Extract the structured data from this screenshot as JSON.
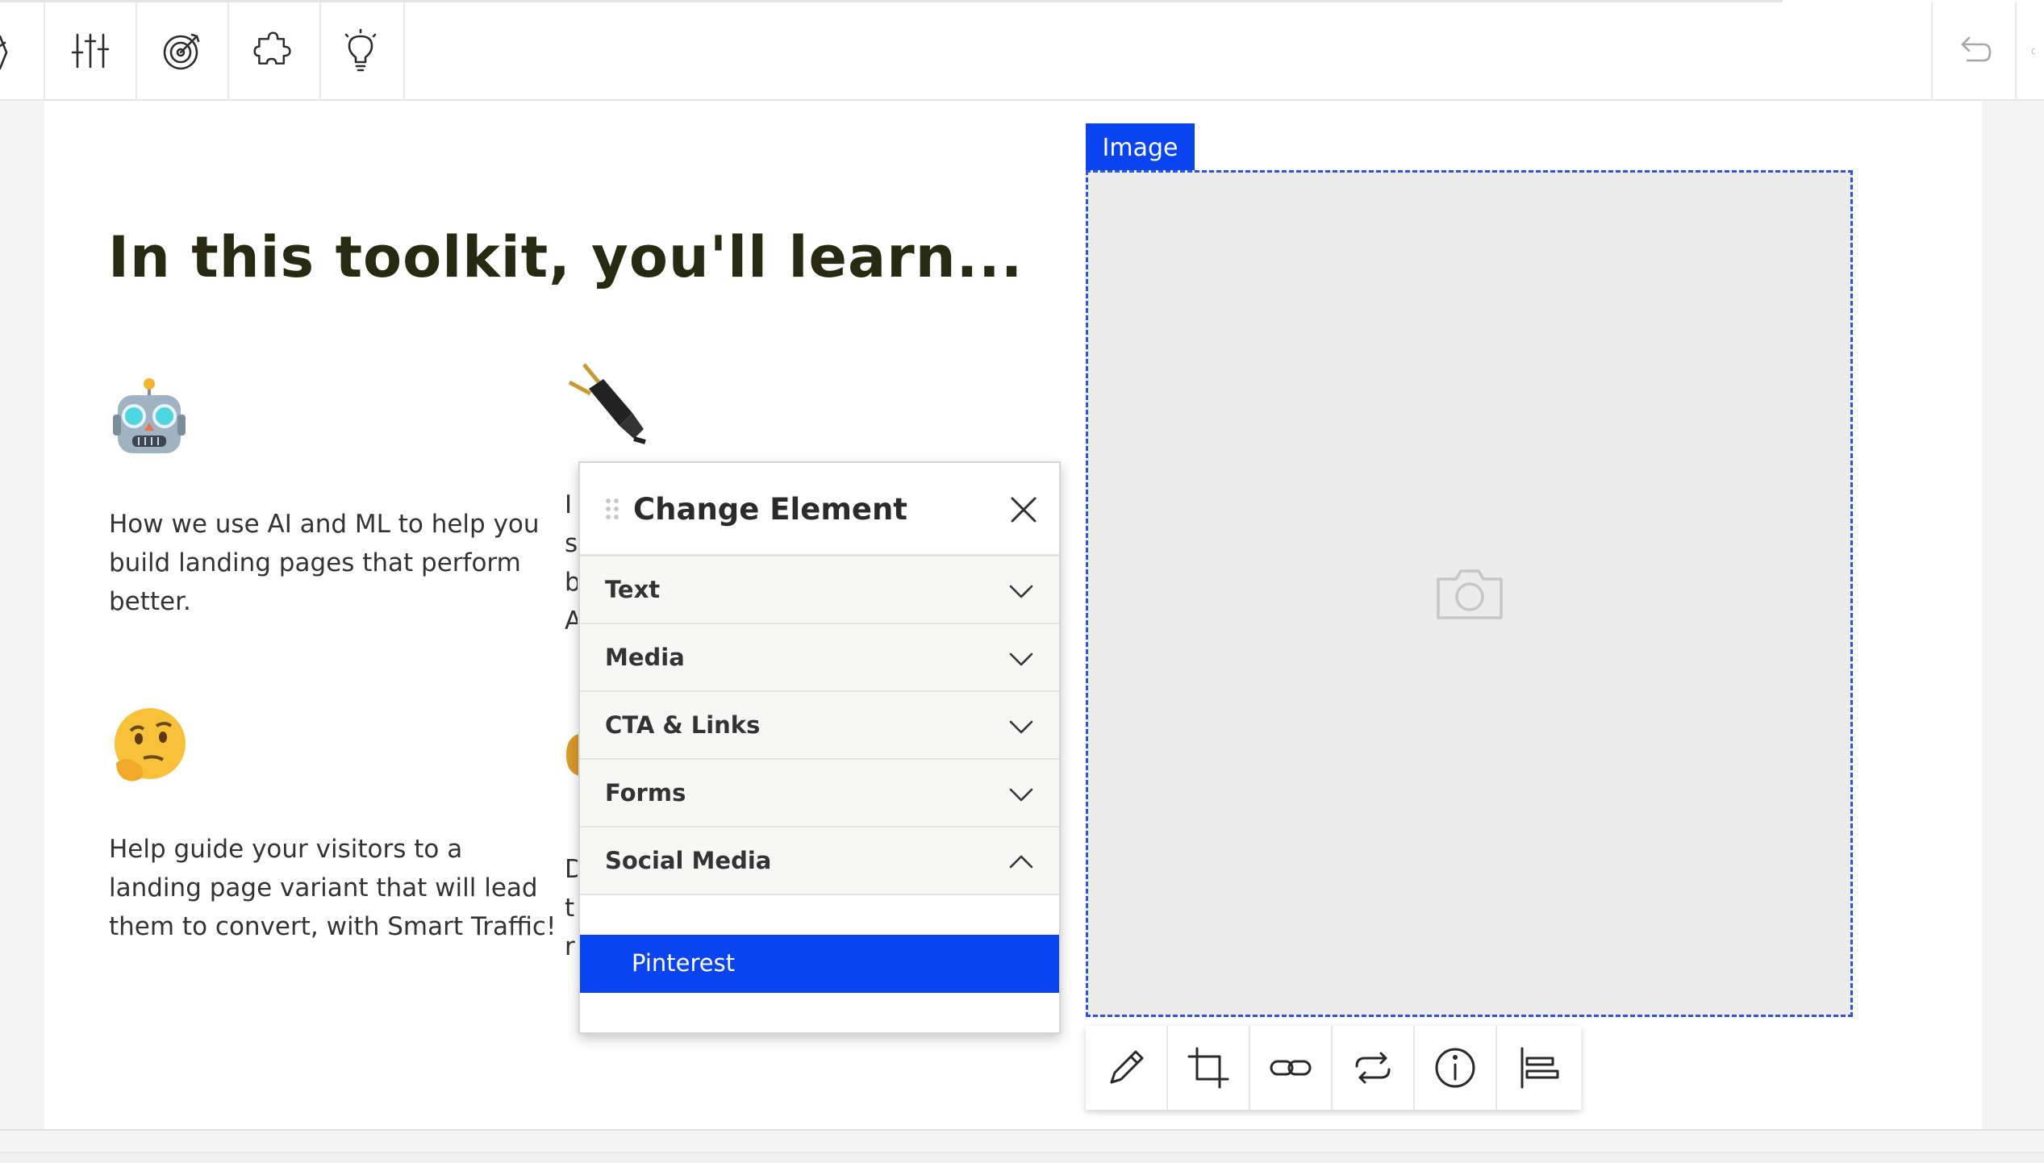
{
  "toolbar": {
    "tools": [
      {
        "name": "page-icon"
      },
      {
        "name": "sliders-icon"
      },
      {
        "name": "target-icon"
      },
      {
        "name": "puzzle-icon"
      },
      {
        "name": "lightbulb-icon"
      }
    ],
    "undo_icon": "undo-icon",
    "redo_icon": "redo-icon"
  },
  "content": {
    "headline": "In this toolkit, you'll learn...",
    "features": [
      {
        "emoji": "robot-emoji",
        "text": "How we use AI and ML to help you build landing pages that perform better."
      },
      {
        "emoji": "plug-emoji",
        "text_partial": [
          "I",
          "s",
          "b",
          "A"
        ]
      },
      {
        "emoji": "thinking-face-emoji",
        "text": "Help guide your visitors to a landing page variant that will lead them to convert, with Smart Traffic!"
      },
      {
        "emoji": "partial-emoji",
        "text_partial": [
          "D",
          "t",
          "r"
        ]
      }
    ]
  },
  "image_element": {
    "tag": "Image",
    "placeholder_icon": "camera-icon",
    "tools": [
      "pencil-icon",
      "crop-icon",
      "link-icon",
      "swap-icon",
      "info-icon",
      "align-left-icon"
    ]
  },
  "change_element_panel": {
    "title": "Change Element",
    "categories": [
      {
        "label": "Text",
        "expanded": false
      },
      {
        "label": "Media",
        "expanded": false
      },
      {
        "label": "CTA & Links",
        "expanded": false
      },
      {
        "label": "Forms",
        "expanded": false
      },
      {
        "label": "Social Media",
        "expanded": true
      }
    ],
    "social_media_items": [
      {
        "label": "Pinterest",
        "selected": true
      }
    ]
  },
  "colors": {
    "accent": "#0a44f0",
    "headline": "#272a10",
    "selection_outline": "#2d54e6"
  }
}
